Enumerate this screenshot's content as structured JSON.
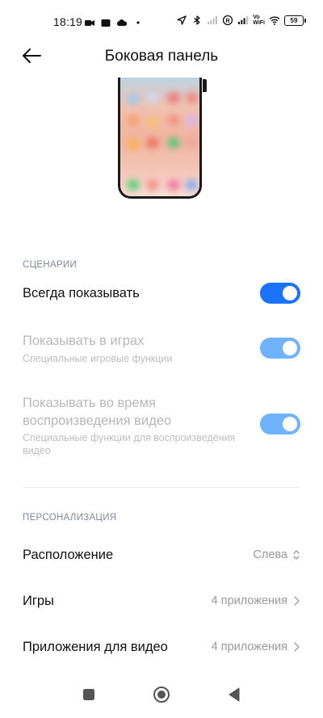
{
  "status_bar": {
    "time": "18:19",
    "battery": "59",
    "vowifi_top": "Vo",
    "vowifi_bottom": "WiFi"
  },
  "header": {
    "title": "Боковая панель"
  },
  "sections": {
    "scenarios": {
      "label": "СЦЕНАРИИ"
    },
    "personalization": {
      "label": "ПЕРСОНАЛИЗАЦИЯ"
    }
  },
  "settings": {
    "always_show": {
      "title": "Всегда показывать",
      "enabled": true
    },
    "show_in_games": {
      "title": "Показывать в играх",
      "subtitle": "Специальные игровые функции",
      "enabled": true
    },
    "show_in_video": {
      "title": "Показывать во время воспроизведения видео",
      "subtitle": "Специальные функции для воспроизведения видео",
      "enabled": true
    },
    "position": {
      "title": "Расположение",
      "value": "Слева"
    },
    "games": {
      "title": "Игры",
      "value": "4 приложения"
    },
    "video_apps": {
      "title": "Приложения для видео",
      "value": "4 приложения"
    }
  },
  "colors": {
    "accent": "#1a73ff",
    "accent_faded": "#6fb2ff",
    "section_label": "#7a8aa5"
  }
}
